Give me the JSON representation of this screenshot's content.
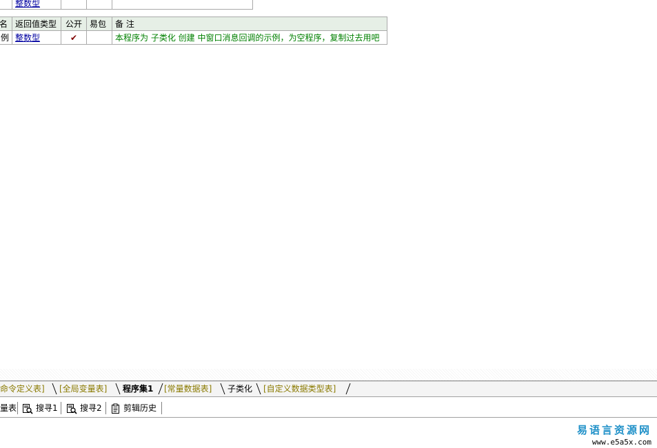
{
  "top_row": {
    "return_type": "整数型"
  },
  "sub_table": {
    "headers": {
      "name": "名",
      "return_type": "返回值类型",
      "public": "公开",
      "epk": "易包",
      "note": "备 注"
    },
    "row": {
      "name": "例",
      "return_type": "整数型",
      "public_mark": "✔",
      "epk": "",
      "note": "本程序为 子类化 创建 中窗口消息回调的示例，为空程序，复制过去用吧"
    }
  },
  "tabs": [
    {
      "label": "命令定义表]",
      "state": "inactive"
    },
    {
      "label": "[全局变量表]",
      "state": "inactive"
    },
    {
      "label": "程序集1",
      "state": "active"
    },
    {
      "label": "[常量数据表]",
      "state": "inactive"
    },
    {
      "label": "子类化",
      "state": "plain"
    },
    {
      "label": "[自定义数据类型表]",
      "state": "inactive"
    }
  ],
  "toolbar": {
    "items": [
      {
        "label": "量表",
        "icon": "none"
      },
      {
        "label": "搜寻1",
        "icon": "search-doc-icon"
      },
      {
        "label": "搜寻2",
        "icon": "search-doc-icon"
      },
      {
        "label": "剪辑历史",
        "icon": "clipboard-icon"
      }
    ]
  },
  "watermark": {
    "brand": "易语言资源网",
    "url": "www.e5a5x.com"
  }
}
